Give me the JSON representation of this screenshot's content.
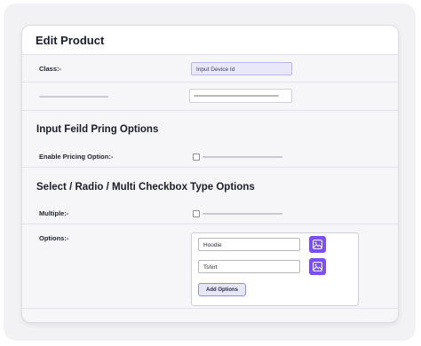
{
  "card": {
    "title": "Edit Product"
  },
  "class_row": {
    "label": "Class:-",
    "value": "Input Device Id"
  },
  "pricing_section": {
    "title": "Input Feild Pring Options",
    "enable_label": "Enable Pricing Option:-"
  },
  "select_section": {
    "title": "Select / Radio / Multi Checkbox Type Options",
    "multiple_label": "Multiple:-",
    "options_label": "Options:-"
  },
  "options": [
    {
      "value": "Hoodie",
      "icon": "image-icon"
    },
    {
      "value": "Tshirt",
      "icon": "image-icon"
    }
  ],
  "add_button": {
    "label": "Add Options"
  },
  "colors": {
    "accent": "#7b4ff0",
    "input_fill": "#e9e8fb"
  }
}
